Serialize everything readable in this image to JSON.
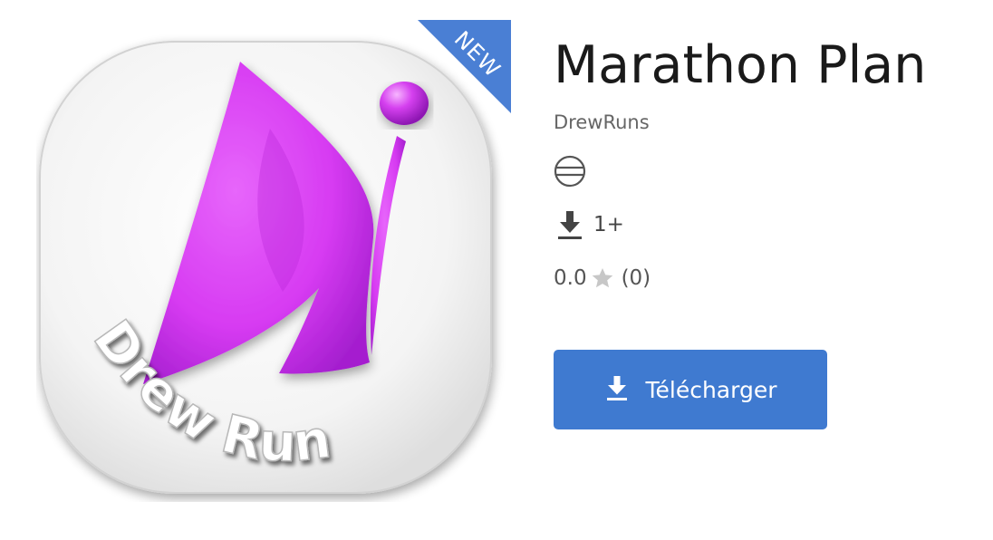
{
  "app": {
    "name": "Marathon Plan",
    "developer": "DrewRuns",
    "logo_text": "Drew Runs",
    "badge": "NEW",
    "downloads": "1+",
    "rating": {
      "score": "0.0",
      "count": "(0)"
    },
    "download_button_label": "Télécharger"
  },
  "icons": {
    "content_rating": "globe-icon",
    "downloads": "download-icon",
    "rating": "star-icon",
    "button": "download-icon"
  },
  "colors": {
    "accent_blue": "#3f7ad0",
    "ribbon_blue": "#4a7fd4",
    "logo_magenta": "#d63cf2",
    "text_dark": "#1a1a1a",
    "text_muted": "#666666"
  }
}
